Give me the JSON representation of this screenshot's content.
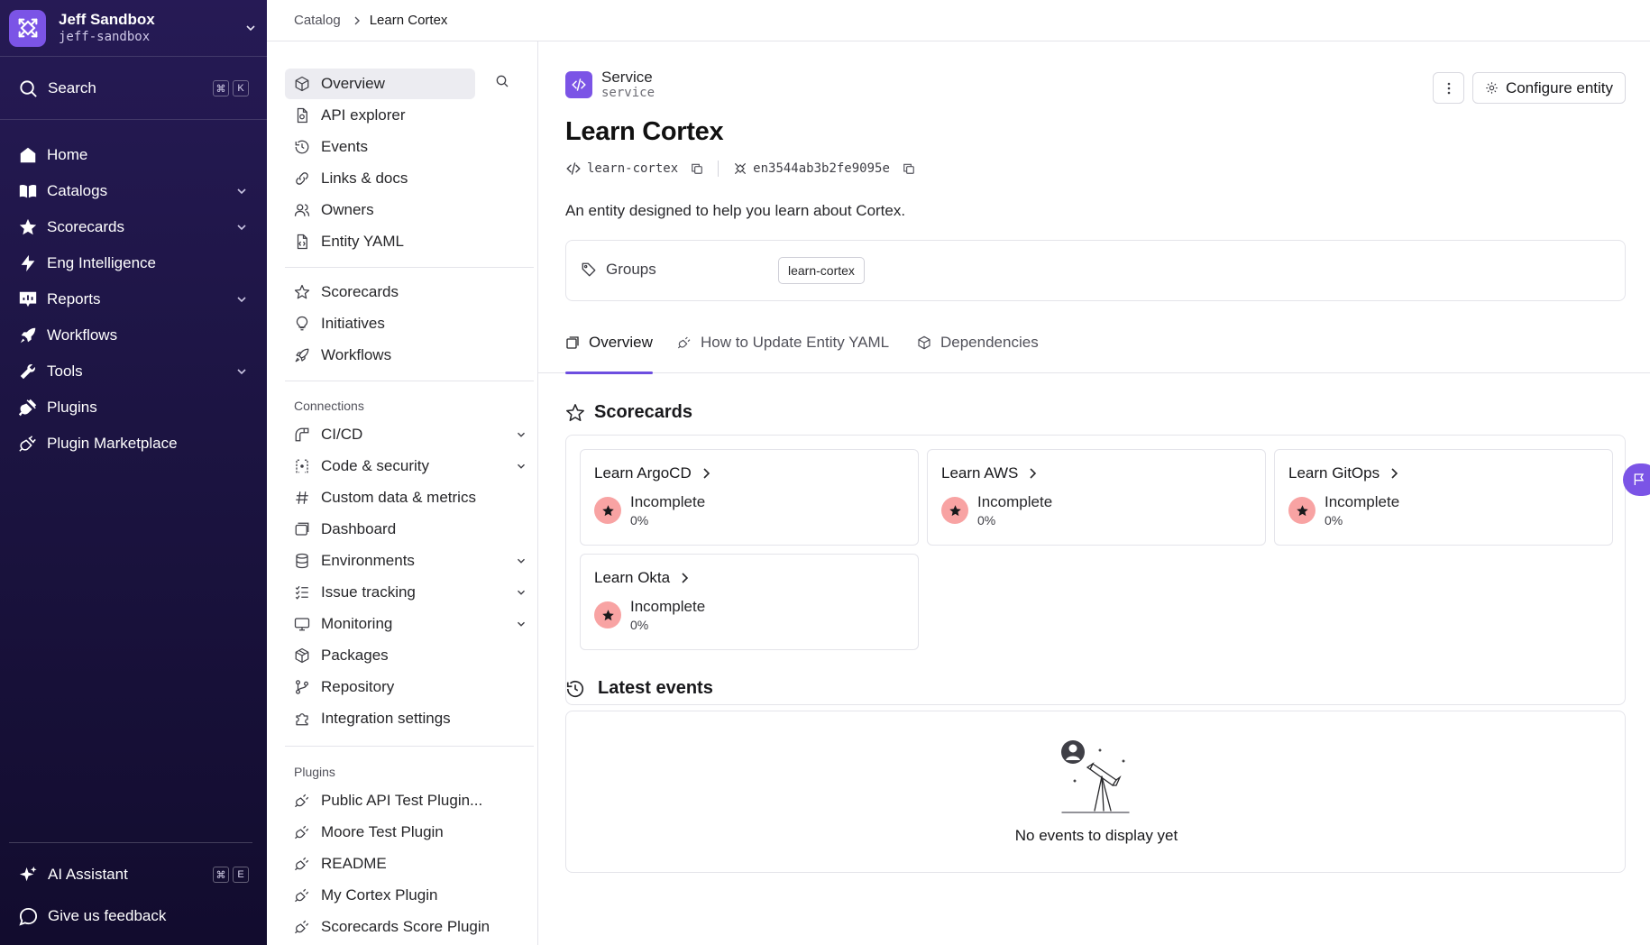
{
  "workspace": {
    "name": "Jeff Sandbox",
    "slug": "jeff-sandbox"
  },
  "nav": {
    "search_label": "Search",
    "search_keys": [
      "⌘",
      "K"
    ],
    "items": [
      {
        "label": "Home",
        "icon": "home-icon",
        "expandable": false
      },
      {
        "label": "Catalogs",
        "icon": "book-icon",
        "expandable": true
      },
      {
        "label": "Scorecards",
        "icon": "star-icon",
        "expandable": true
      },
      {
        "label": "Eng Intelligence",
        "icon": "lightning-icon",
        "expandable": false
      },
      {
        "label": "Reports",
        "icon": "report-icon",
        "expandable": true
      },
      {
        "label": "Workflows",
        "icon": "rocket-icon",
        "expandable": false
      },
      {
        "label": "Tools",
        "icon": "wrench-icon",
        "expandable": true
      },
      {
        "label": "Plugins",
        "icon": "plug-icon",
        "expandable": false
      },
      {
        "label": "Plugin Marketplace",
        "icon": "plug-outline-icon",
        "expandable": false
      }
    ],
    "ai_assistant": {
      "label": "AI Assistant",
      "keys": [
        "⌘",
        "E"
      ]
    },
    "feedback_label": "Give us feedback"
  },
  "breadcrumb": {
    "parent": "Catalog",
    "current": "Learn Cortex"
  },
  "subnav": {
    "primary": [
      {
        "label": "Overview",
        "icon": "cube-icon",
        "active": true
      },
      {
        "label": "API explorer",
        "icon": "document-icon"
      },
      {
        "label": "Events",
        "icon": "history-icon"
      },
      {
        "label": "Links & docs",
        "icon": "link-icon"
      },
      {
        "label": "Owners",
        "icon": "users-icon"
      },
      {
        "label": "Entity YAML",
        "icon": "file-code-icon"
      }
    ],
    "secondary": [
      {
        "label": "Scorecards",
        "icon": "star-outline-icon"
      },
      {
        "label": "Initiatives",
        "icon": "lightbulb-icon"
      },
      {
        "label": "Workflows",
        "icon": "rocket-outline-icon"
      }
    ],
    "connections_heading": "Connections",
    "connections": [
      {
        "label": "CI/CD",
        "icon": "pipeline-icon",
        "expandable": true
      },
      {
        "label": "Code & security",
        "icon": "code-bracket-icon",
        "expandable": true
      },
      {
        "label": "Custom data & metrics",
        "icon": "hash-icon",
        "expandable": false
      },
      {
        "label": "Dashboard",
        "icon": "dashboard-icon",
        "expandable": false
      },
      {
        "label": "Environments",
        "icon": "database-icon",
        "expandable": true
      },
      {
        "label": "Issue tracking",
        "icon": "checklist-icon",
        "expandable": true
      },
      {
        "label": "Monitoring",
        "icon": "monitor-icon",
        "expandable": true
      },
      {
        "label": "Packages",
        "icon": "package-icon",
        "expandable": false
      },
      {
        "label": "Repository",
        "icon": "branch-icon",
        "expandable": false
      },
      {
        "label": "Integration settings",
        "icon": "puzzle-icon",
        "expandable": false
      }
    ],
    "plugins_heading": "Plugins",
    "plugins": [
      {
        "label": "Public API Test Plugin...",
        "icon": "plug-outline-icon"
      },
      {
        "label": "Moore Test Plugin",
        "icon": "plug-outline-icon"
      },
      {
        "label": "README",
        "icon": "plug-outline-icon"
      },
      {
        "label": "My Cortex Plugin",
        "icon": "plug-outline-icon"
      },
      {
        "label": "Scorecards Score Plugin",
        "icon": "plug-outline-icon"
      }
    ]
  },
  "entity": {
    "type_label": "Service",
    "type_code": "service",
    "title": "Learn Cortex",
    "tag": "learn-cortex",
    "id": "en3544ab3b2fe9095e",
    "description": "An entity designed to help you learn about Cortex.",
    "groups_label": "Groups",
    "groups": [
      "learn-cortex"
    ],
    "configure_label": "Configure entity"
  },
  "tabs": [
    {
      "label": "Overview",
      "icon": "window-icon",
      "active": true
    },
    {
      "label": "How to Update Entity YAML",
      "icon": "plug-outline-icon",
      "active": false
    },
    {
      "label": "Dependencies",
      "icon": "cube-icon",
      "active": false
    }
  ],
  "scorecards_section": {
    "title": "Scorecards",
    "cards": [
      {
        "name": "Learn ArgoCD",
        "status": "Incomplete",
        "percent": "0%"
      },
      {
        "name": "Learn AWS",
        "status": "Incomplete",
        "percent": "0%"
      },
      {
        "name": "Learn GitOps",
        "status": "Incomplete",
        "percent": "0%"
      },
      {
        "name": "Learn Okta",
        "status": "Incomplete",
        "percent": "0%"
      }
    ]
  },
  "events_section": {
    "title": "Latest events",
    "empty_text": "No events to display yet"
  },
  "colors": {
    "accent": "#7b54e6",
    "nav_bg": "#1c1442",
    "badge_incomplete": "#f8a3a3"
  }
}
